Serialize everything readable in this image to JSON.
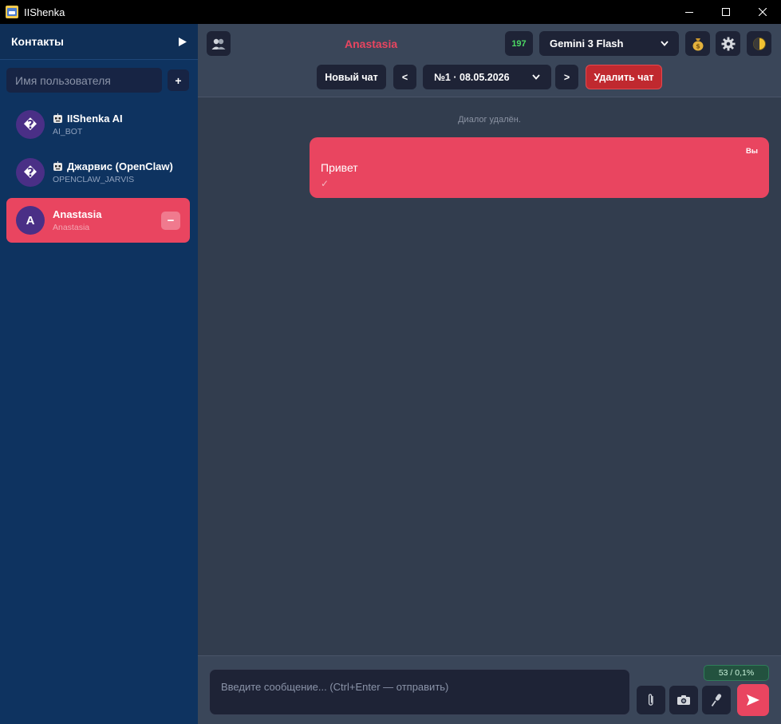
{
  "window": {
    "title": "IIShenka"
  },
  "sidebar": {
    "title": "Контакты",
    "toggle_icon": "play-arrow-icon",
    "search_placeholder": "Имя пользователя",
    "add_label": "+",
    "contacts": [
      {
        "avatar": "�",
        "name": "IIShenka AI",
        "handle": "AI_BOT",
        "is_bot": true,
        "active": false
      },
      {
        "avatar": "�",
        "name": "Джарвис (OpenClaw)",
        "handle": "OPENCLAW_JARVIS",
        "is_bot": true,
        "active": false
      },
      {
        "avatar": "A",
        "name": "Anastasia",
        "handle": "Anastasia",
        "is_bot": false,
        "active": true,
        "remove_label": "−"
      }
    ]
  },
  "header": {
    "chat_name": "Anastasia",
    "token_count": "197",
    "model": "Gemini 3 Flash",
    "new_chat_label": "Новый чат",
    "prev_label": "<",
    "next_label": ">",
    "chat_session": "№1 · 08.05.2026",
    "delete_chat_label": "Удалить чат"
  },
  "messages": {
    "system_note": "Диалог удалён.",
    "items": [
      {
        "sender": "Вы",
        "text": "Привет",
        "status": "✓"
      }
    ]
  },
  "composer": {
    "placeholder": "Введите сообщение... (Ctrl+Enter — отправить)",
    "counter": "53 / 0,1%"
  },
  "colors": {
    "accent": "#e94560",
    "sidebar_bg": "#0e3360",
    "main_bg": "#323d4e",
    "control_bg": "#1e2336",
    "danger": "#c0292f",
    "token_green": "#4cd964"
  }
}
